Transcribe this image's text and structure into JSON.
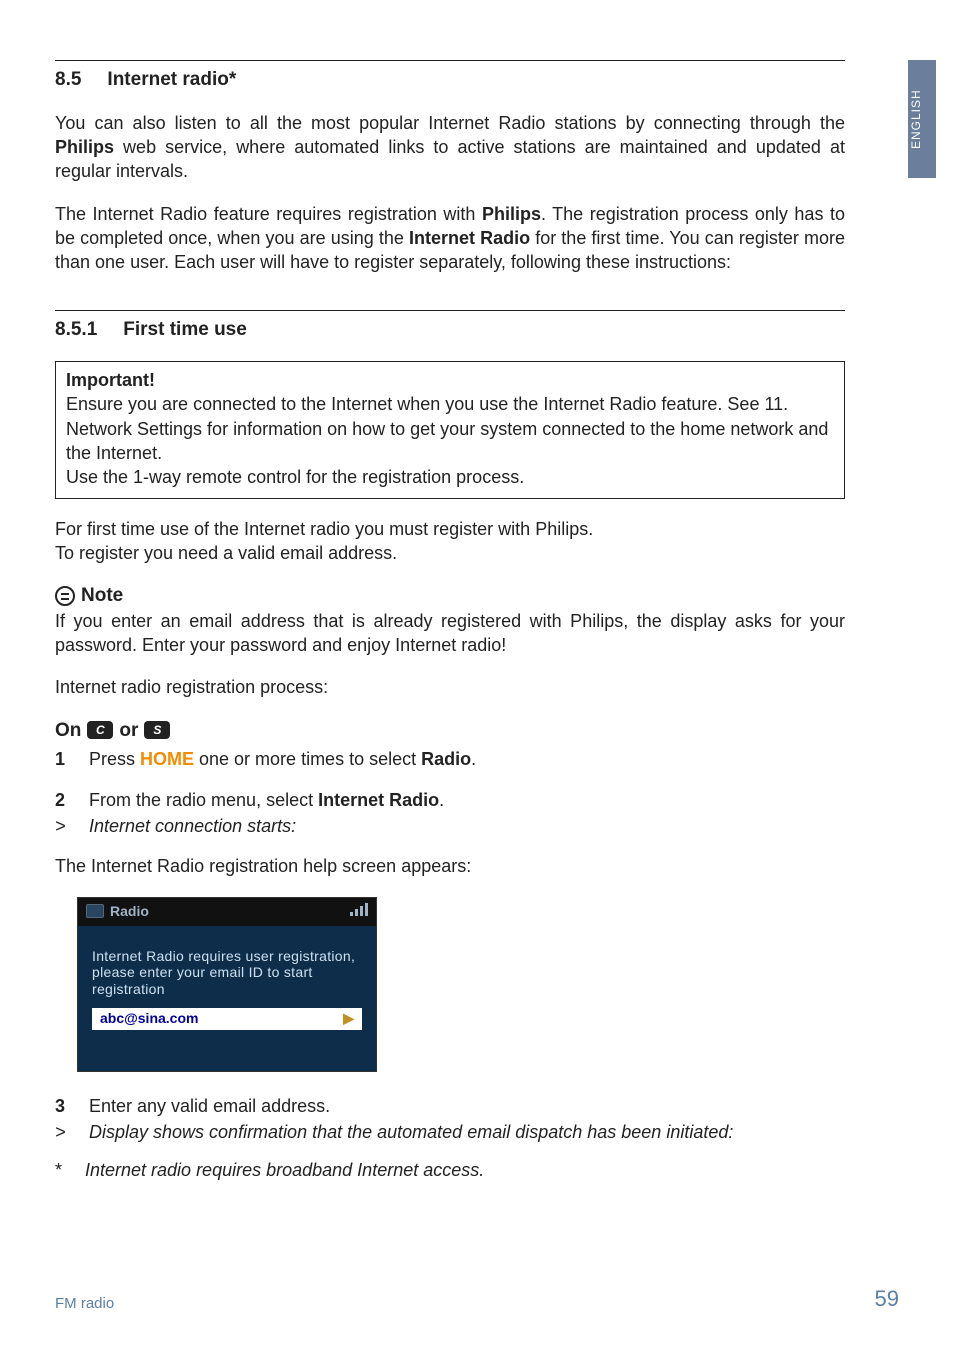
{
  "side_tab": "ENGLISH",
  "sec85": {
    "num": "8.5",
    "title": "Internet radio*"
  },
  "p1a": "You can also listen to all the most popular Internet Radio stations by connecting through the ",
  "p1b": "Philips",
  "p1c": " web service, where automated links to active stations are maintained and updated at regular intervals.",
  "p2a": "The Internet Radio feature requires registration with ",
  "p2b": "Philips",
  "p2c": ". The registration process only has to be completed once, when you are using the ",
  "p2d": "Internet Radio",
  "p2e": " for the first time. You can register more than one user. Each user will have to register separately, following these instructions:",
  "sec851": {
    "num": "8.5.1",
    "title": "First time use"
  },
  "box": {
    "title": "Important!",
    "l1": "Ensure you are connected to the Internet when you use the Internet Radio feature. See 11. Network Settings for information on how to get your system connected to the home network and the Internet.",
    "l2": "Use the 1-way remote control for the registration process."
  },
  "p3": "For first time use of the Internet radio you must register with Philips.",
  "p4": "To register you need a valid email address.",
  "note_label": "Note",
  "note_text": "If you enter an email address that is already registered with Philips, the display asks for your password. Enter your password and enjoy Internet radio!",
  "p5": "Internet radio registration process:",
  "on_label_a": "On ",
  "on_label_or": " or ",
  "chip_c": "C",
  "chip_s": "S",
  "steps": {
    "s1": {
      "n": "1",
      "a": "Press ",
      "b": "HOME",
      "c": " one or more times to select ",
      "d": "Radio",
      "e": "."
    },
    "s2": {
      "n": "2",
      "a": "From the radio menu, select ",
      "b": "Internet Radio",
      "c": "."
    },
    "s2r": {
      "gt": ">",
      "txt": "Internet connection starts:"
    },
    "s3": {
      "n": "3",
      "txt": "Enter any valid email address."
    },
    "s3r": {
      "gt": ">",
      "txt": "Display shows confirmation that the automated email dispatch has been initiated:"
    }
  },
  "p6": "The Internet Radio registration help screen appears:",
  "screenshot": {
    "header": "Radio",
    "body": "Internet Radio requires user registration, please enter your email ID to start registration",
    "input": "abc@sina.com",
    "arrow": "▶"
  },
  "footnote": {
    "star": "*",
    "txt": "Internet radio requires broadband Internet access."
  },
  "footer": {
    "left": "FM radio",
    "right": "59"
  }
}
